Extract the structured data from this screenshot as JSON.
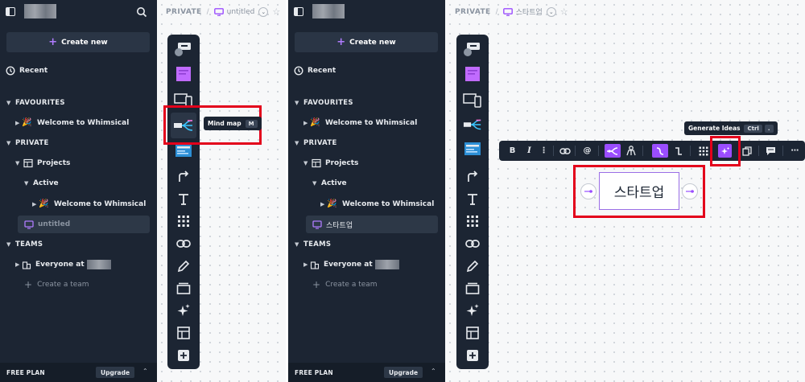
{
  "left": {
    "sidebar": {
      "create_label": "Create new",
      "recent_label": "Recent",
      "favourites_label": "FAVOURITES",
      "favourite_item": "Welcome to Whimsical",
      "private_label": "PRIVATE",
      "projects_label": "Projects",
      "active_label": "Active",
      "active_item": "Welcome to Whimsical",
      "selected_file": "untitled",
      "teams_label": "TEAMS",
      "team_item": "Everyone at",
      "create_team_label": "Create a team",
      "plan_label": "FREE PLAN",
      "upgrade_label": "Upgrade"
    },
    "breadcrumb": {
      "space": "PRIVATE",
      "file": "untitled"
    },
    "tooltip": {
      "label": "Mind map",
      "shortcut": "M"
    }
  },
  "right": {
    "sidebar": {
      "create_label": "Create new",
      "recent_label": "Recent",
      "favourites_label": "FAVOURITES",
      "favourite_item": "Welcome to Whimsical",
      "private_label": "PRIVATE",
      "projects_label": "Projects",
      "active_label": "Active",
      "active_item": "Welcome to Whimsical",
      "selected_file": "스타트업",
      "teams_label": "TEAMS",
      "team_item": "Everyone at",
      "create_team_label": "Create a team",
      "plan_label": "FREE PLAN",
      "upgrade_label": "Upgrade"
    },
    "breadcrumb": {
      "space": "PRIVATE",
      "file": "스타트업"
    },
    "tooltip": {
      "label": "Generate Ideas",
      "shortcut": "Ctrl",
      "shortcut2": "."
    },
    "format_bar": {
      "bold": "B",
      "italic": "I",
      "mention": "@"
    },
    "node": {
      "text": "스타트업"
    }
  },
  "colors": {
    "sidebar_bg": "#1c2533",
    "accent": "#9b4dff",
    "highlight_box": "#e3001b"
  },
  "icons": [
    "sidebar-toggle-icon",
    "search-icon",
    "plus-icon",
    "clock-icon",
    "party-popper-icon",
    "board-icon",
    "file-icon",
    "team-icon",
    "star-icon",
    "chevron-down-icon",
    "chevron-up-icon",
    "flowchart-icon",
    "sticky-note-icon",
    "wireframe-icon",
    "mindmap-icon",
    "doc-icon",
    "arrow-icon",
    "text-icon",
    "grid-icon",
    "link-icon",
    "pencil-icon",
    "frame-icon",
    "sparkle-icon",
    "table-icon",
    "add-icon",
    "comment-icon",
    "more-icon"
  ]
}
